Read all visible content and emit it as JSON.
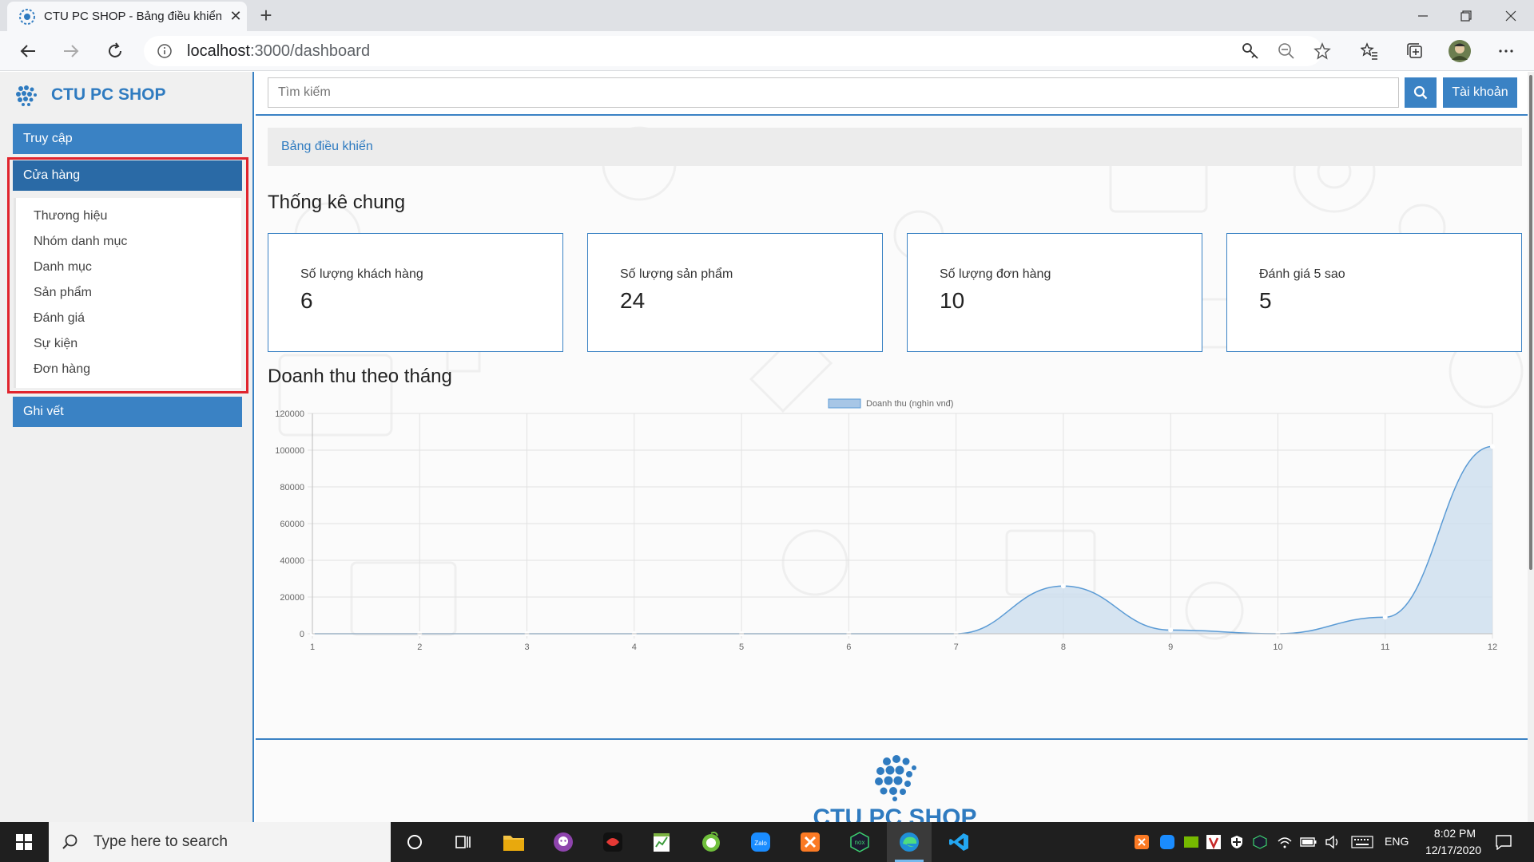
{
  "browser": {
    "tab_title": "CTU PC SHOP - Bảng điều khiển",
    "url_host": "localhost",
    "url_path": ":3000/dashboard"
  },
  "sidebar": {
    "brand": "CTU PC SHOP",
    "menu": {
      "access": "Truy cập",
      "store": "Cửa hàng",
      "log": "Ghi vết"
    },
    "sub_items": [
      "Thương hiệu",
      "Nhóm danh mục",
      "Danh mục",
      "Sản phẩm",
      "Đánh giá",
      "Sự kiện",
      "Đơn hàng"
    ]
  },
  "header": {
    "search_placeholder": "Tìm kiếm",
    "account_label": "Tài khoản"
  },
  "breadcrumb": "Bảng điều khiển",
  "stats": {
    "title": "Thống kê chung",
    "cards": [
      {
        "label": "Số lượng khách hàng",
        "value": "6"
      },
      {
        "label": "Số lượng sản phẩm",
        "value": "24"
      },
      {
        "label": "Số lượng đơn hàng",
        "value": "10"
      },
      {
        "label": "Đánh giá 5 sao",
        "value": "5"
      }
    ]
  },
  "revenue_title": "Doanh thu theo tháng",
  "footer_brand": "CTU PC SHOP",
  "chart_data": {
    "type": "area",
    "x": [
      1,
      2,
      3,
      4,
      5,
      6,
      7,
      8,
      9,
      10,
      11,
      12
    ],
    "series": [
      {
        "name": "Doanh thu (nghìn vnđ)",
        "values": [
          0,
          0,
          0,
          0,
          0,
          0,
          0,
          26000,
          2000,
          0,
          9000,
          102000
        ]
      }
    ],
    "yticks": [
      0,
      20000,
      40000,
      60000,
      80000,
      100000,
      120000
    ],
    "ylim": [
      0,
      120000
    ],
    "grid": true,
    "legend_position": "top",
    "colors": {
      "line": "#5b9bd5",
      "fill": "#c9dcee"
    }
  },
  "taskbar": {
    "search_placeholder": "Type here to search",
    "language": "ENG",
    "time": "8:02 PM",
    "date": "12/17/2020"
  }
}
